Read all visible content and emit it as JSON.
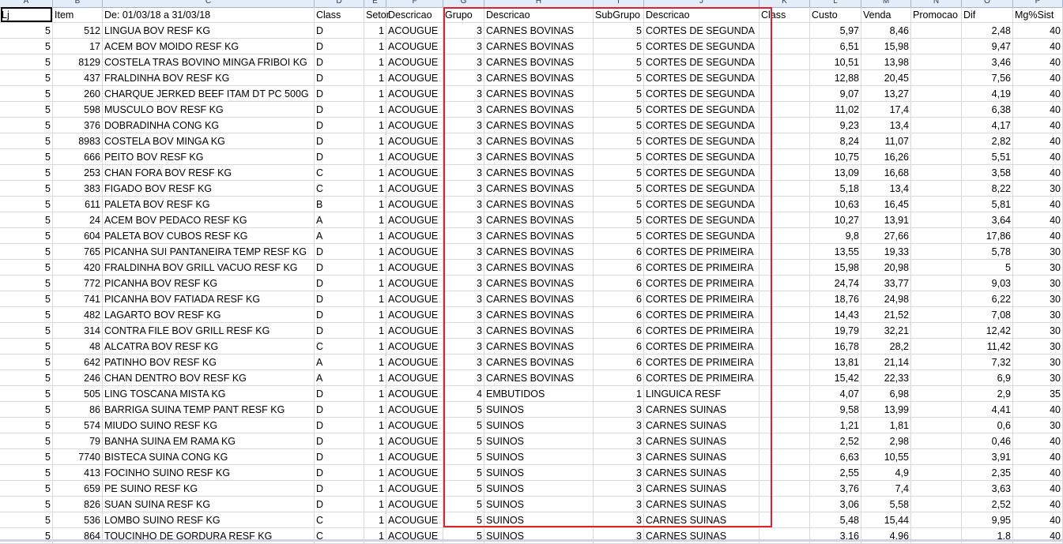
{
  "column_letters": [
    "A",
    "B",
    "C",
    "D",
    "E",
    "F",
    "G",
    "H",
    "I",
    "J",
    "K",
    "L",
    "M",
    "N",
    "O",
    "P"
  ],
  "header": [
    "Lj",
    "Item",
    "De: 01/03/18 a 31/03/18",
    "Class",
    "Setor",
    "Descricao",
    "Grupo",
    "Descricao",
    "SubGrupo",
    "Descricao",
    "Class",
    "Custo",
    "Venda",
    "Promocao",
    "Dif",
    "Mg%Sist"
  ],
  "rows": [
    [
      "5",
      "512",
      "LINGUA BOV RESF KG",
      "D",
      "1",
      "ACOUGUE",
      "3",
      "CARNES BOVINAS",
      "5",
      "CORTES DE SEGUNDA",
      "",
      "5,97",
      "8,46",
      "",
      "2,48",
      "40"
    ],
    [
      "5",
      "17",
      "ACEM BOV MOIDO RESF KG",
      "D",
      "1",
      "ACOUGUE",
      "3",
      "CARNES BOVINAS",
      "5",
      "CORTES DE SEGUNDA",
      "",
      "6,51",
      "15,98",
      "",
      "9,47",
      "40"
    ],
    [
      "5",
      "8129",
      "COSTELA TRAS BOVINO MINGA FRIBOI KG",
      "D",
      "1",
      "ACOUGUE",
      "3",
      "CARNES BOVINAS",
      "5",
      "CORTES DE SEGUNDA",
      "",
      "10,51",
      "13,98",
      "",
      "3,46",
      "40"
    ],
    [
      "5",
      "437",
      "FRALDINHA BOV RESF KG",
      "D",
      "1",
      "ACOUGUE",
      "3",
      "CARNES BOVINAS",
      "5",
      "CORTES DE SEGUNDA",
      "",
      "12,88",
      "20,45",
      "",
      "7,56",
      "40"
    ],
    [
      "5",
      "260",
      "CHARQUE JERKED BEEF ITAM DT PC 500G",
      "D",
      "1",
      "ACOUGUE",
      "3",
      "CARNES BOVINAS",
      "5",
      "CORTES DE SEGUNDA",
      "",
      "9,07",
      "13,27",
      "",
      "4,19",
      "40"
    ],
    [
      "5",
      "598",
      "MUSCULO BOV RESF KG",
      "D",
      "1",
      "ACOUGUE",
      "3",
      "CARNES BOVINAS",
      "5",
      "CORTES DE SEGUNDA",
      "",
      "11,02",
      "17,4",
      "",
      "6,38",
      "40"
    ],
    [
      "5",
      "376",
      "DOBRADINHA CONG KG",
      "D",
      "1",
      "ACOUGUE",
      "3",
      "CARNES BOVINAS",
      "5",
      "CORTES DE SEGUNDA",
      "",
      "9,23",
      "13,4",
      "",
      "4,17",
      "40"
    ],
    [
      "5",
      "8983",
      "COSTELA BOV MINGA KG",
      "D",
      "1",
      "ACOUGUE",
      "3",
      "CARNES BOVINAS",
      "5",
      "CORTES DE SEGUNDA",
      "",
      "8,24",
      "11,07",
      "",
      "2,82",
      "40"
    ],
    [
      "5",
      "666",
      "PEITO BOV RESF KG",
      "D",
      "1",
      "ACOUGUE",
      "3",
      "CARNES BOVINAS",
      "5",
      "CORTES DE SEGUNDA",
      "",
      "10,75",
      "16,26",
      "",
      "5,51",
      "40"
    ],
    [
      "5",
      "253",
      "CHAN FORA BOV RESF KG",
      "C",
      "1",
      "ACOUGUE",
      "3",
      "CARNES BOVINAS",
      "5",
      "CORTES DE SEGUNDA",
      "",
      "13,09",
      "16,68",
      "",
      "3,58",
      "40"
    ],
    [
      "5",
      "383",
      "FIGADO BOV RESF KG",
      "C",
      "1",
      "ACOUGUE",
      "3",
      "CARNES BOVINAS",
      "5",
      "CORTES DE SEGUNDA",
      "",
      "5,18",
      "13,4",
      "",
      "8,22",
      "30"
    ],
    [
      "5",
      "611",
      "PALETA BOV RESF KG",
      "B",
      "1",
      "ACOUGUE",
      "3",
      "CARNES BOVINAS",
      "5",
      "CORTES DE SEGUNDA",
      "",
      "10,63",
      "16,45",
      "",
      "5,81",
      "40"
    ],
    [
      "5",
      "24",
      "ACEM BOV PEDACO RESF KG",
      "A",
      "1",
      "ACOUGUE",
      "3",
      "CARNES BOVINAS",
      "5",
      "CORTES DE SEGUNDA",
      "",
      "10,27",
      "13,91",
      "",
      "3,64",
      "40"
    ],
    [
      "5",
      "604",
      "PALETA BOV CUBOS RESF KG",
      "A",
      "1",
      "ACOUGUE",
      "3",
      "CARNES BOVINAS",
      "5",
      "CORTES DE SEGUNDA",
      "",
      "9,8",
      "27,66",
      "",
      "17,86",
      "40"
    ],
    [
      "5",
      "765",
      "PICANHA SUI PANTANEIRA TEMP RESF KG",
      "D",
      "1",
      "ACOUGUE",
      "3",
      "CARNES BOVINAS",
      "6",
      "CORTES DE PRIMEIRA",
      "",
      "13,55",
      "19,33",
      "",
      "5,78",
      "30"
    ],
    [
      "5",
      "420",
      "FRALDINHA BOV GRILL VACUO RESF KG",
      "D",
      "1",
      "ACOUGUE",
      "3",
      "CARNES BOVINAS",
      "6",
      "CORTES DE PRIMEIRA",
      "",
      "15,98",
      "20,98",
      "",
      "5",
      "30"
    ],
    [
      "5",
      "772",
      "PICANHA BOV RESF KG",
      "D",
      "1",
      "ACOUGUE",
      "3",
      "CARNES BOVINAS",
      "6",
      "CORTES DE PRIMEIRA",
      "",
      "24,74",
      "33,77",
      "",
      "9,03",
      "30"
    ],
    [
      "5",
      "741",
      "PICANHA BOV FATIADA RESF KG",
      "D",
      "1",
      "ACOUGUE",
      "3",
      "CARNES BOVINAS",
      "6",
      "CORTES DE PRIMEIRA",
      "",
      "18,76",
      "24,98",
      "",
      "6,22",
      "30"
    ],
    [
      "5",
      "482",
      "LAGARTO BOV RESF KG",
      "D",
      "1",
      "ACOUGUE",
      "3",
      "CARNES BOVINAS",
      "6",
      "CORTES DE PRIMEIRA",
      "",
      "14,43",
      "21,52",
      "",
      "7,08",
      "30"
    ],
    [
      "5",
      "314",
      "CONTRA FILE BOV GRILL RESF KG",
      "D",
      "1",
      "ACOUGUE",
      "3",
      "CARNES BOVINAS",
      "6",
      "CORTES DE PRIMEIRA",
      "",
      "19,79",
      "32,21",
      "",
      "12,42",
      "30"
    ],
    [
      "5",
      "48",
      "ALCATRA BOV RESF KG",
      "C",
      "1",
      "ACOUGUE",
      "3",
      "CARNES BOVINAS",
      "6",
      "CORTES DE PRIMEIRA",
      "",
      "16,78",
      "28,2",
      "",
      "11,42",
      "30"
    ],
    [
      "5",
      "642",
      "PATINHO BOV RESF KG",
      "A",
      "1",
      "ACOUGUE",
      "3",
      "CARNES BOVINAS",
      "6",
      "CORTES DE PRIMEIRA",
      "",
      "13,81",
      "21,14",
      "",
      "7,32",
      "30"
    ],
    [
      "5",
      "246",
      "CHAN DENTRO BOV RESF KG",
      "A",
      "1",
      "ACOUGUE",
      "3",
      "CARNES BOVINAS",
      "6",
      "CORTES DE PRIMEIRA",
      "",
      "15,42",
      "22,33",
      "",
      "6,9",
      "30"
    ],
    [
      "5",
      "505",
      "LING TOSCANA MISTA KG",
      "D",
      "1",
      "ACOUGUE",
      "4",
      "EMBUTIDOS",
      "1",
      "LINGUICA RESF",
      "",
      "4,07",
      "6,98",
      "",
      "2,9",
      "35"
    ],
    [
      "5",
      "86",
      "BARRIGA SUINA TEMP PANT RESF KG",
      "D",
      "1",
      "ACOUGUE",
      "5",
      "SUINOS",
      "3",
      "CARNES SUINAS",
      "",
      "9,58",
      "13,99",
      "",
      "4,41",
      "40"
    ],
    [
      "5",
      "574",
      "MIUDO SUINO RESF KG",
      "D",
      "1",
      "ACOUGUE",
      "5",
      "SUINOS",
      "3",
      "CARNES SUINAS",
      "",
      "1,21",
      "1,81",
      "",
      "0,6",
      "30"
    ],
    [
      "5",
      "79",
      "BANHA SUINA EM RAMA KG",
      "D",
      "1",
      "ACOUGUE",
      "5",
      "SUINOS",
      "3",
      "CARNES SUINAS",
      "",
      "2,52",
      "2,98",
      "",
      "0,46",
      "40"
    ],
    [
      "5",
      "7740",
      "BISTECA SUINA CONG KG",
      "D",
      "1",
      "ACOUGUE",
      "5",
      "SUINOS",
      "3",
      "CARNES SUINAS",
      "",
      "6,63",
      "10,55",
      "",
      "3,91",
      "40"
    ],
    [
      "5",
      "413",
      "FOCINHO SUINO RESF KG",
      "D",
      "1",
      "ACOUGUE",
      "5",
      "SUINOS",
      "3",
      "CARNES SUINAS",
      "",
      "2,55",
      "4,9",
      "",
      "2,35",
      "40"
    ],
    [
      "5",
      "659",
      "PE SUINO RESF KG",
      "D",
      "1",
      "ACOUGUE",
      "5",
      "SUINOS",
      "3",
      "CARNES SUINAS",
      "",
      "3,76",
      "7,4",
      "",
      "3,63",
      "40"
    ],
    [
      "5",
      "826",
      "SUAN SUINA RESF KG",
      "D",
      "1",
      "ACOUGUE",
      "5",
      "SUINOS",
      "3",
      "CARNES SUINAS",
      "",
      "3,06",
      "5,58",
      "",
      "2,52",
      "40"
    ],
    [
      "5",
      "536",
      "LOMBO SUINO RESF KG",
      "C",
      "1",
      "ACOUGUE",
      "5",
      "SUINOS",
      "3",
      "CARNES SUINAS",
      "",
      "5,48",
      "15,44",
      "",
      "9,95",
      "40"
    ],
    [
      "5",
      "864",
      "TOUCINHO DE GORDURA RESF KG",
      "C",
      "1",
      "ACOUGUE",
      "5",
      "SUINOS",
      "3",
      "CARNES SUINAS",
      "",
      "3,16",
      "4,96",
      "",
      "1,8",
      "40"
    ]
  ],
  "colors": {
    "highlight_border": "#e0212b",
    "gridline": "#d9d9d9",
    "header_bg": "#e4ecf7"
  }
}
